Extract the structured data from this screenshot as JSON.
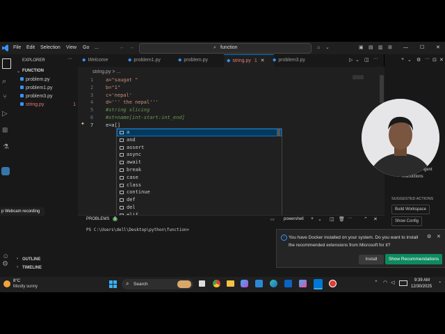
{
  "titlebar": {
    "menus": [
      "File",
      "Edit",
      "Selection",
      "View",
      "Go",
      "..."
    ],
    "search_text": "function"
  },
  "sidebar": {
    "header": "EXPLORER",
    "folder": "FUNCTION",
    "files": [
      {
        "name": "problem.py"
      },
      {
        "name": "problem1.py"
      },
      {
        "name": "problem3.py"
      },
      {
        "name": "string.py",
        "badge": "1"
      }
    ],
    "outline": "OUTLINE",
    "timeline": "TIMELINE"
  },
  "tabs": [
    {
      "label": "Welcome"
    },
    {
      "label": "problem1.py"
    },
    {
      "label": "problem.py"
    },
    {
      "label": "string.py",
      "badge": "1"
    },
    {
      "label": "problem3.py"
    }
  ],
  "breadcrumb": "string.py > ...",
  "editor": {
    "lines": [
      {
        "num": "1",
        "text": "a=\"saugat \""
      },
      {
        "num": "2",
        "text": "b=\"1\""
      },
      {
        "num": "3",
        "text": "c='nepal'"
      },
      {
        "num": "4",
        "text": "d=''' the nepal'''"
      },
      {
        "num": "5",
        "text": "#string slicing"
      },
      {
        "num": "6",
        "text": "#st=name[int-start:int_end]"
      },
      {
        "num": "7",
        "text": "e=a[]"
      }
    ]
  },
  "suggestions": [
    "a",
    "and",
    "assert",
    "async",
    "await",
    "break",
    "case",
    "class",
    "continue",
    "def",
    "del",
    "elif"
  ],
  "panel": {
    "tab_label": "PROBLEMS",
    "tab_badge": "5",
    "terminal_type": "powershell",
    "prompt": "PS C:\\Users\\dell\\Desktop\\python\\function>"
  },
  "webcam_label": "p Webcam recording",
  "right_panel": {
    "agent_text": "Agent",
    "instructions_text": "Instructions",
    "suggested_actions": "SUGGESTED ACTIONS",
    "build_workspace": "Build Workspace",
    "show_config": "Show Config"
  },
  "notification": {
    "message": "You have Docker installed on your system. Do you want to install the recommended extensions from Microsoft for it?",
    "install": "Install",
    "show_recommendations": "Show Recommendations"
  },
  "taskbar": {
    "weather_temp": "8°C",
    "weather_desc": "Mostly sunny",
    "search_label": "Search",
    "time": "9:39 AM",
    "date": "12/30/2025"
  },
  "colors": {
    "accent": "#0078d4",
    "vscode_blue": "#3794ff",
    "notification_button": "#0e8a5f",
    "python_keyword": "#569cd6",
    "comment": "#6a9955",
    "string": "#ce9178"
  }
}
